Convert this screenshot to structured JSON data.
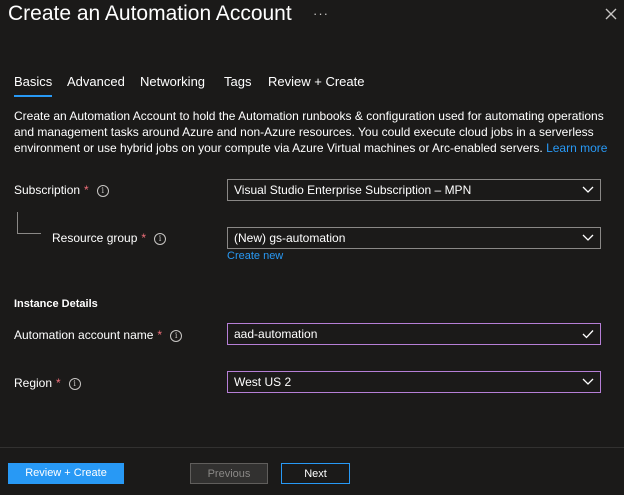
{
  "header": {
    "title": "Create an Automation Account",
    "more_icon": "ellipsis-icon",
    "close_icon": "close-icon"
  },
  "tabs": [
    {
      "label": "Basics",
      "active": true
    },
    {
      "label": "Advanced",
      "active": false
    },
    {
      "label": "Networking",
      "active": false
    },
    {
      "label": "Tags",
      "active": false
    },
    {
      "label": "Review + Create",
      "active": false
    }
  ],
  "description": {
    "text": "Create an Automation Account to hold the Automation runbooks & configuration used for automating operations and management tasks around Azure and non-Azure resources. You could execute cloud jobs in a serverless environment or use hybrid jobs on your compute via Azure Virtual machines or Arc-enabled servers.",
    "link": "Learn more"
  },
  "form": {
    "subscription": {
      "label": "Subscription",
      "required": "*",
      "value": "Visual Studio Enterprise Subscription – MPN"
    },
    "resource_group": {
      "label": "Resource group",
      "required": "*",
      "value": "(New) gs-automation",
      "create_new": "Create new"
    },
    "instance_details": "Instance Details",
    "account_name": {
      "label": "Automation account name",
      "required": "*",
      "value": "aad-automation"
    },
    "region": {
      "label": "Region",
      "required": "*",
      "value": "West US 2"
    }
  },
  "footer": {
    "review_create": "Review + Create",
    "previous": "Previous",
    "next": "Next"
  },
  "colors": {
    "background": "#1b1a19",
    "accent": "#2899f5",
    "required": "#f1707b",
    "focus_border": "#b67fd6"
  }
}
